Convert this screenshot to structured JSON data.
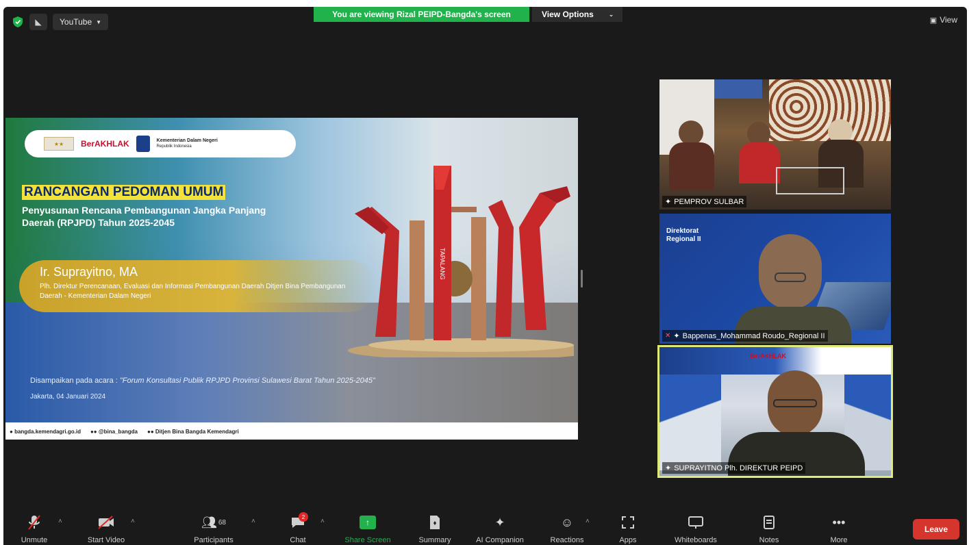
{
  "topbar": {
    "source_label": "YouTube",
    "banner": "You are viewing Rizal PEIPD-Bangda's screen",
    "view_options": "View Options",
    "view_right": "View"
  },
  "slide": {
    "brand": "BerAKHLAK",
    "badge": "BANGGA MELAYANI BANGSA",
    "ministry": "Kementerian Dalam Negeri",
    "ministry_sub": "Republik Indonesia",
    "title": "RANCANGAN PEDOMAN UMUM",
    "subtitle": "Penyusunan Rencana Pembangunan Jangka Panjang Daerah (RPJPD) Tahun 2025-2045",
    "speaker_name": "Ir. Suprayitno, MA",
    "speaker_role": "Plh. Direktur Perencanaan, Evaluasi dan Informasi Pembangunan Daerah Ditjen Bina Pembangunan Daerah - Kementerian Dalam Negeri",
    "event_prefix": "Disampaikan pada acara : ",
    "event_name": "\"Forum Konsultasi Publik RPJPD Provinsi Sulawesi Barat Tahun 2025-2045\"",
    "event_date": "Jakarta, 04 Januari 2024",
    "monument_text": "TAPALANG",
    "footer_web": "bangda.kemendagri.go.id",
    "footer_social": "@bina_bangda",
    "footer_channel": "Ditjen Bina Bangda Kemendagri"
  },
  "videos": [
    {
      "name": "PEMPROV SULBAR"
    },
    {
      "name": "Bappenas_Mohammad Roudo_Regional II",
      "slide_title": "Direktorat Regional II"
    },
    {
      "name": "SUPRAYITNO Plh. DIREKTUR PEIPD",
      "brand": "BerAKHLAK"
    }
  ],
  "toolbar": {
    "unmute": "Unmute",
    "start_video": "Start Video",
    "participants": "Participants",
    "participant_count": "68",
    "chat": "Chat",
    "chat_badge": "2",
    "share_screen": "Share Screen",
    "summary": "Summary",
    "ai_companion": "AI Companion",
    "reactions": "Reactions",
    "apps": "Apps",
    "whiteboards": "Whiteboards",
    "notes": "Notes",
    "more": "More",
    "leave": "Leave"
  },
  "colors": {
    "background": "#1a1a1a",
    "banner_green": "#22b24c",
    "leave_red": "#d6352d",
    "active_speaker_border": "#dfe87a"
  }
}
